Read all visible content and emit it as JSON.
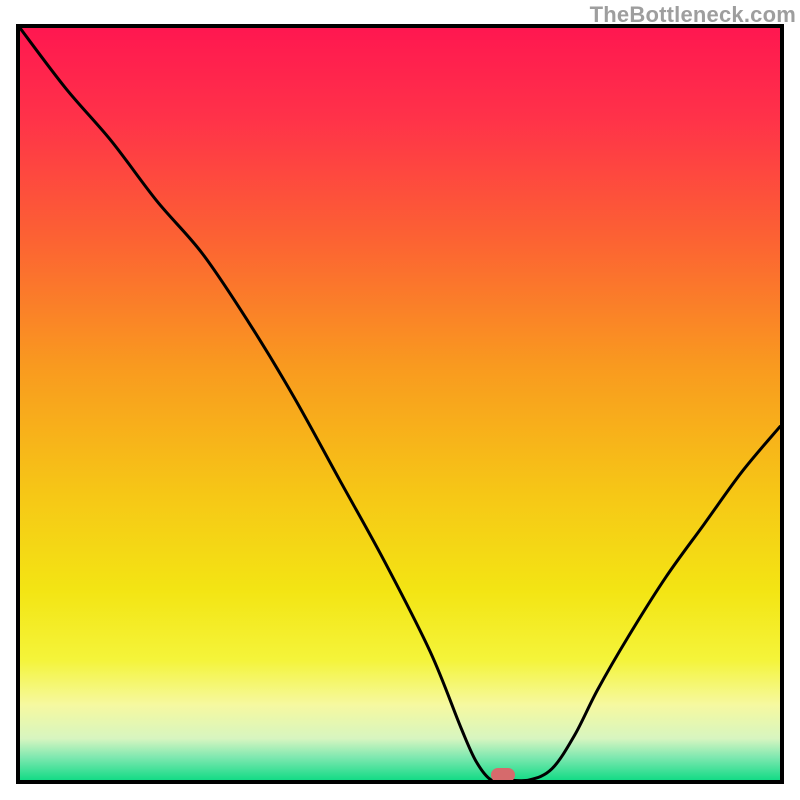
{
  "watermark": "TheBottleneck.com",
  "background": {
    "stops": [
      {
        "offset": 0.0,
        "color": "#ff1750"
      },
      {
        "offset": 0.12,
        "color": "#ff3249"
      },
      {
        "offset": 0.28,
        "color": "#fc6233"
      },
      {
        "offset": 0.45,
        "color": "#f99a1f"
      },
      {
        "offset": 0.62,
        "color": "#f6c716"
      },
      {
        "offset": 0.75,
        "color": "#f3e514"
      },
      {
        "offset": 0.84,
        "color": "#f4f43a"
      },
      {
        "offset": 0.9,
        "color": "#f6f9a0"
      },
      {
        "offset": 0.945,
        "color": "#d7f5c0"
      },
      {
        "offset": 0.97,
        "color": "#7ee8b0"
      },
      {
        "offset": 1.0,
        "color": "#14db86"
      }
    ]
  },
  "chart_data": {
    "type": "line",
    "title": "",
    "xlabel": "",
    "ylabel": "",
    "xlim": [
      0,
      100
    ],
    "ylim": [
      0,
      100
    ],
    "series": [
      {
        "name": "bottleneck-curve",
        "x": [
          0,
          6,
          12,
          18,
          24,
          30,
          36,
          42,
          48,
          54,
          58,
          60,
          62,
          64,
          67,
          70,
          73,
          76,
          80,
          85,
          90,
          95,
          100
        ],
        "values": [
          100,
          92,
          85,
          77,
          70,
          61,
          51,
          40,
          29,
          17,
          7,
          2.5,
          0,
          0,
          0,
          1.5,
          6,
          12,
          19,
          27,
          34,
          41,
          47
        ]
      }
    ],
    "marker": {
      "x": 63.5,
      "y": 0.7,
      "name": "optimal-point"
    }
  }
}
